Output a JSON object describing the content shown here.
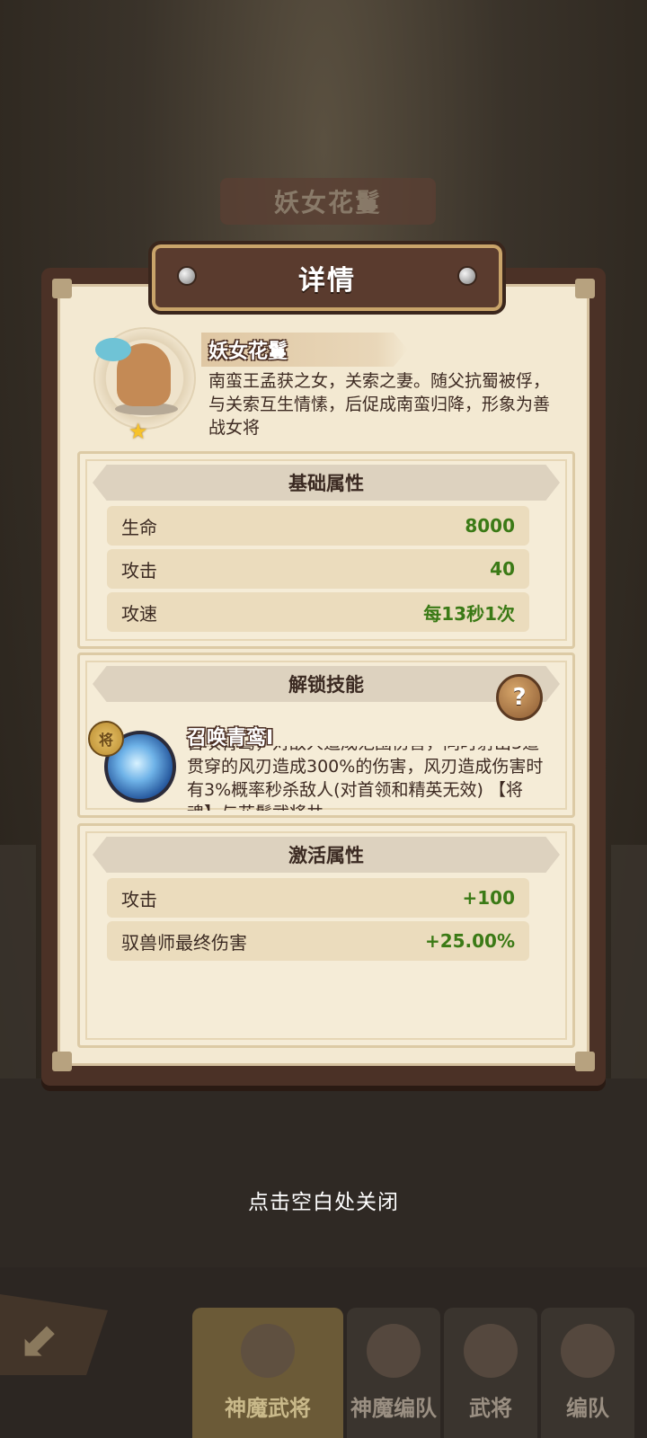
{
  "background": {
    "banner_title": "妖女花鬘"
  },
  "modal": {
    "title": "详情",
    "hero": {
      "name": "妖女花鬘",
      "description": "南蛮王孟获之女，关索之妻。随父抗蜀被俘，与关索互生情愫，后促成南蛮归降，形象为善战女将",
      "stars": "★"
    },
    "base_attributes": {
      "header": "基础属性",
      "rows": [
        {
          "label": "生命",
          "value": "8000"
        },
        {
          "label": "攻击",
          "value": "40"
        },
        {
          "label": "攻速",
          "value": "每13秒1次"
        }
      ]
    },
    "unlock_skill": {
      "header": "解锁技能",
      "help_icon": "?",
      "badge_icon": "将",
      "name": "召唤青鸾Ⅰ",
      "description": "召唤青鸾，对敌人造成范围伤害，同时射出3道贯穿的风刃造成300%的伤害，风刃造成伤害时有3%概率秒杀敌人(对首领和精英无效) 【将魂】与花鬘武将共"
    },
    "activate_attributes": {
      "header": "激活属性",
      "rows": [
        {
          "label": "攻击",
          "value": "+100"
        },
        {
          "label": "驭兽师最终伤害",
          "value": "+25.00%"
        }
      ]
    }
  },
  "close_hint": "点击空白处关闭",
  "bottom_tabs": [
    {
      "label": "神魔武将",
      "active": true
    },
    {
      "label": "神魔编队",
      "active": false
    },
    {
      "label": "武将",
      "active": false
    },
    {
      "label": "编队",
      "active": false
    }
  ],
  "colors": {
    "modal_frame": "#4b3126",
    "parchment": "#f3e9d2",
    "stat_value_green": "#3b7a16",
    "star_gold": "#f6c22b"
  }
}
